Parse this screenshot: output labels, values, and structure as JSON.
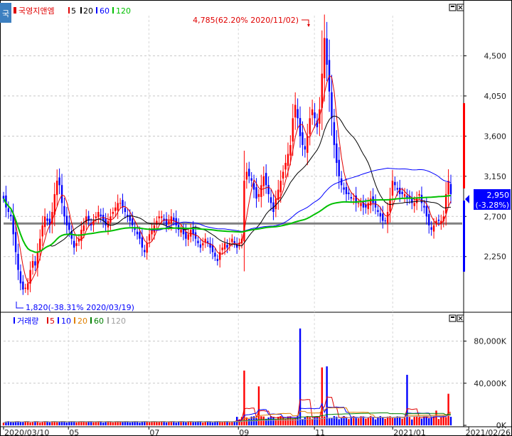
{
  "price_panel": {
    "name": "국영지앤엠",
    "ma_labels": [
      "5",
      "20",
      "60",
      "120"
    ],
    "ma_colors": [
      "#e00000",
      "#000000",
      "#0000ff",
      "#00c000"
    ],
    "side_tab": "국",
    "high_annotation": "4,785(62.20% 2020/11/02)",
    "low_annotation": "1,820(-38.31% 2020/03/19)",
    "current_price": "2,950",
    "current_change": "(-3.28%)"
  },
  "volume_panel": {
    "name": "거래량",
    "ma_labels": [
      "5",
      "10",
      "20",
      "60",
      "120"
    ],
    "ma_colors": [
      "#e00000",
      "#0000ff",
      "#e08000",
      "#008000",
      "#a0a0a0"
    ]
  },
  "colors": {
    "up": "#ff0000",
    "down": "#0000ff",
    "ma5": "#e00000",
    "ma20": "#000000",
    "ma60": "#0000ff",
    "ma120": "#00c000",
    "support_line": "#808080"
  },
  "chart_data": [
    {
      "type": "candlestick",
      "title": "국영지앤엠",
      "series_names": [
        "5",
        "20",
        "60",
        "120"
      ],
      "y_ticks": [
        2250,
        2700,
        3150,
        3600,
        4050,
        4500
      ],
      "y_tick_labels": [
        "2,250",
        "2,700",
        "3,150",
        "3,600",
        "4,050",
        "4,500"
      ],
      "ylim": [
        1650,
        4950
      ],
      "x_tick_labels": [
        "2020/03/10",
        "05",
        "07",
        "09",
        "11",
        "2021/01",
        "2021/02/26"
      ],
      "high": {
        "date": "2020/11/02",
        "value": 4785,
        "pct": 62.2
      },
      "low": {
        "date": "2020/03/19",
        "value": 1820,
        "pct": -38.31
      },
      "last_close": 2950,
      "last_change_pct": -3.28,
      "support_level": 2620,
      "closes": [
        2900,
        2800,
        2750,
        2700,
        2500,
        2300,
        2100,
        1950,
        1880,
        1900,
        1950,
        2100,
        2200,
        2150,
        2300,
        2450,
        2600,
        2700,
        2650,
        2600,
        2750,
        2950,
        3100,
        3050,
        2850,
        2700,
        2600,
        2550,
        2450,
        2350,
        2400,
        2450,
        2550,
        2600,
        2700,
        2650,
        2600,
        2650,
        2700,
        2750,
        2700,
        2650,
        2600,
        2650,
        2700,
        2750,
        2800,
        2850,
        2850,
        2800,
        2750,
        2700,
        2650,
        2600,
        2550,
        2500,
        2450,
        2350,
        2300,
        2400,
        2500,
        2550,
        2600,
        2650,
        2700,
        2700,
        2650,
        2600,
        2650,
        2700,
        2650,
        2600,
        2550,
        2550,
        2500,
        2450,
        2500,
        2550,
        2500,
        2450,
        2400,
        2350,
        2400,
        2450,
        2400,
        2350,
        2300,
        2250,
        2200,
        2300,
        2350,
        2400,
        2350,
        2400,
        2450,
        2400,
        2350,
        2400,
        2450,
        3100,
        3200,
        3150,
        3100,
        3000,
        2900,
        2950,
        3050,
        3150,
        3050,
        2950,
        2850,
        2750,
        2900,
        3000,
        3100,
        3200,
        3300,
        3400,
        3500,
        3800,
        3950,
        3800,
        3600,
        3500,
        3450,
        3600,
        3800,
        3900,
        3800,
        3700,
        3900,
        4300,
        4700,
        4400,
        4100,
        3800,
        3500,
        3300,
        3150,
        3050,
        3000,
        2950,
        2950,
        2900,
        2900,
        2850,
        2850,
        2850,
        2800,
        2800,
        2850,
        2900,
        2850,
        2800,
        2750,
        2700,
        2650,
        2650,
        2750,
        2900,
        3100,
        3050,
        3000,
        2950,
        2950,
        2950,
        2900,
        2900,
        2850,
        2850,
        2900,
        2950,
        2850,
        2800,
        2700,
        2600,
        2550,
        2600,
        2650,
        2650,
        2650,
        2700,
        2950,
        3100,
        2950
      ],
      "volume_ticks": [
        0,
        40000,
        80000
      ],
      "volume_tick_labels": [
        "0K",
        "40,000K",
        "80,000K"
      ],
      "volume_ylim": [
        0,
        100000
      ],
      "volume_spikes": [
        {
          "index": 99,
          "value": 52000
        },
        {
          "index": 105,
          "value": 37000
        },
        {
          "index": 122,
          "value": 92000
        },
        {
          "index": 131,
          "value": 55000
        },
        {
          "index": 133,
          "value": 56000
        },
        {
          "index": 166,
          "value": 48000
        },
        {
          "index": 178,
          "value": 14000
        },
        {
          "index": 183,
          "value": 30000
        }
      ],
      "volume_base": 2500
    }
  ]
}
